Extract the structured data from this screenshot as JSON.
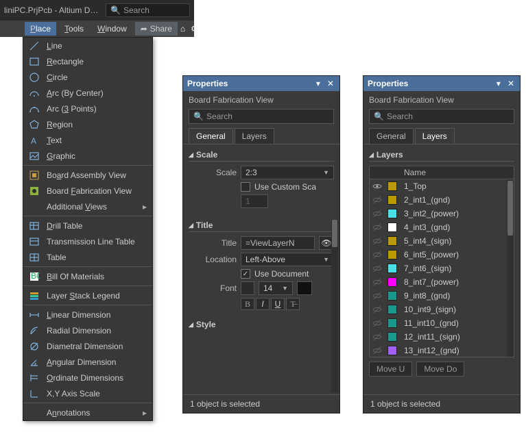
{
  "title_bar": {
    "title": "liniPC.PrjPcb - Altium Desig...",
    "search_placeholder": "Search"
  },
  "menubar": {
    "items": [
      {
        "label": "Place",
        "accel": "P",
        "active": true
      },
      {
        "label": "Tools",
        "accel": "T"
      },
      {
        "label": "Window",
        "accel": "W"
      }
    ],
    "share": "Share"
  },
  "dropdown": {
    "groups": [
      [
        {
          "icon": "line",
          "label": "Line",
          "accel": "L"
        },
        {
          "icon": "rect",
          "label": "Rectangle",
          "accel": "R"
        },
        {
          "icon": "circle",
          "label": "Circle",
          "accel": "C"
        },
        {
          "icon": "arc-center",
          "label": "Arc (By Center)",
          "accel": "A"
        },
        {
          "icon": "arc-3pt",
          "label": "Arc (3 Points)",
          "accel": "3"
        },
        {
          "icon": "region",
          "label": "Region",
          "accel": "R"
        },
        {
          "icon": "text",
          "label": "Text",
          "accel": "T"
        },
        {
          "icon": "graphic",
          "label": "Graphic",
          "accel": "G"
        }
      ],
      [
        {
          "icon": "bav",
          "label": "Board Assembly View",
          "accel": "A"
        },
        {
          "icon": "bfv",
          "label": "Board Fabrication View",
          "accel": "F"
        },
        {
          "icon": "addl",
          "label": "Additional Views",
          "accel": "V",
          "sub": true
        }
      ],
      [
        {
          "icon": "dtable",
          "label": "Drill Table",
          "accel": "D"
        },
        {
          "icon": "tltable",
          "label": "Transmission Line Table"
        },
        {
          "icon": "table",
          "label": "Table"
        }
      ],
      [
        {
          "icon": "bom",
          "label": "Bill Of Materials",
          "accel": "B"
        }
      ],
      [
        {
          "icon": "lsl",
          "label": "Layer Stack Legend",
          "accel": "S"
        }
      ],
      [
        {
          "icon": "ldim",
          "label": "Linear Dimension",
          "accel": "L"
        },
        {
          "icon": "rdim",
          "label": "Radial Dimension"
        },
        {
          "icon": "ddim",
          "label": "Diametral Dimension"
        },
        {
          "icon": "adim",
          "label": "Angular Dimension",
          "accel": "A"
        },
        {
          "icon": "odim",
          "label": "Ordinate Dimensions",
          "accel": "O"
        },
        {
          "icon": "xys",
          "label": "X,Y Axis Scale"
        }
      ],
      [
        {
          "icon": "anno",
          "label": "Annotations",
          "accel": "n",
          "sub": true
        }
      ]
    ]
  },
  "prop_left": {
    "title": "Properties",
    "subtitle": "Board Fabrication View",
    "search_placeholder": "Search",
    "tabs": [
      "General",
      "Layers"
    ],
    "active_tab": 0,
    "scale": {
      "heading": "Scale",
      "label": "Scale",
      "value": "2:3",
      "use_custom_label": "Use Custom Sca",
      "custom_value": "1"
    },
    "titlesec": {
      "heading": "Title",
      "title_label": "Title",
      "title_value": "=ViewLayerN",
      "location_label": "Location",
      "location_value": "Left-Above",
      "use_doc_label": "Use Document",
      "use_doc_checked": true,
      "font_label": "Font",
      "font_size": "14"
    },
    "stylesec": {
      "heading": "Style"
    },
    "status": "1 object is selected"
  },
  "prop_right": {
    "title": "Properties",
    "subtitle": "Board Fabrication View",
    "search_placeholder": "Search",
    "tabs": [
      "General",
      "Layers"
    ],
    "active_tab": 1,
    "layers_heading": "Layers",
    "name_col": "Name",
    "layers": [
      {
        "vis": true,
        "color": "#b79b00",
        "name": "1_Top"
      },
      {
        "vis": false,
        "color": "#b79b00",
        "name": "2_int1_(gnd)"
      },
      {
        "vis": false,
        "color": "#49e0e6",
        "name": "3_int2_(power)"
      },
      {
        "vis": false,
        "color": "#ffffff",
        "name": "4_int3_(gnd)"
      },
      {
        "vis": false,
        "color": "#b79b00",
        "name": "5_int4_(sign)"
      },
      {
        "vis": false,
        "color": "#b79b00",
        "name": "6_int5_(power)"
      },
      {
        "vis": false,
        "color": "#49e0e6",
        "name": "7_int6_(sign)"
      },
      {
        "vis": false,
        "color": "#ff00ff",
        "name": "8_int7_(power)"
      },
      {
        "vis": false,
        "color": "#1a998c",
        "name": "9_int8_(gnd)"
      },
      {
        "vis": false,
        "color": "#1a998c",
        "name": "10_int9_(sign)"
      },
      {
        "vis": false,
        "color": "#1a998c",
        "name": "11_int10_(gnd)"
      },
      {
        "vis": false,
        "color": "#1a998c",
        "name": "12_int11_(sign)"
      },
      {
        "vis": false,
        "color": "#a060ff",
        "name": "13_int12_(gnd)"
      }
    ],
    "move_up": "Move U",
    "move_down": "Move Do",
    "status": "1 object is selected"
  },
  "colors": {
    "accent": "#4a6f9b"
  }
}
